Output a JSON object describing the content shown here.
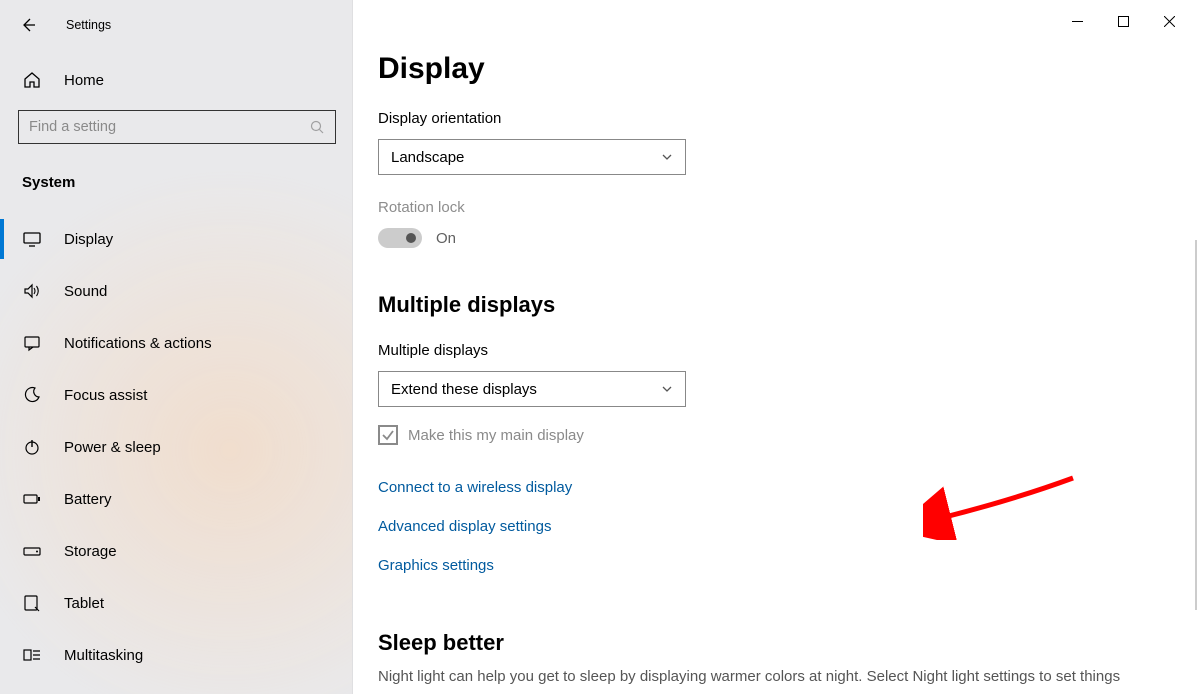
{
  "header": {
    "back_tooltip": "Back",
    "app_title": "Settings"
  },
  "window_controls": {
    "minimize": "Minimize",
    "maximize": "Maximize",
    "close": "Close"
  },
  "sidebar": {
    "home_label": "Home",
    "search_placeholder": "Find a setting",
    "section_label": "System",
    "items": [
      {
        "key": "display",
        "label": "Display",
        "active": true
      },
      {
        "key": "sound",
        "label": "Sound"
      },
      {
        "key": "notifications",
        "label": "Notifications & actions"
      },
      {
        "key": "focus-assist",
        "label": "Focus assist"
      },
      {
        "key": "power-sleep",
        "label": "Power & sleep"
      },
      {
        "key": "battery",
        "label": "Battery"
      },
      {
        "key": "storage",
        "label": "Storage"
      },
      {
        "key": "tablet",
        "label": "Tablet"
      },
      {
        "key": "multitasking",
        "label": "Multitasking"
      }
    ]
  },
  "main": {
    "page_title": "Display",
    "orientation": {
      "label": "Display orientation",
      "value": "Landscape"
    },
    "rotation_lock": {
      "label": "Rotation lock",
      "state_label": "On",
      "disabled": true
    },
    "multiple_displays": {
      "section_title": "Multiple displays",
      "label": "Multiple displays",
      "value": "Extend these displays",
      "make_main_label": "Make this my main display",
      "make_main_checked": true,
      "make_main_disabled": true
    },
    "links": {
      "connect_wireless": "Connect to a wireless display",
      "advanced_display": "Advanced display settings",
      "graphics": "Graphics settings"
    },
    "sleep_better": {
      "title": "Sleep better",
      "body": "Night light can help you get to sleep by displaying warmer colors at night. Select Night light settings to set things"
    }
  }
}
